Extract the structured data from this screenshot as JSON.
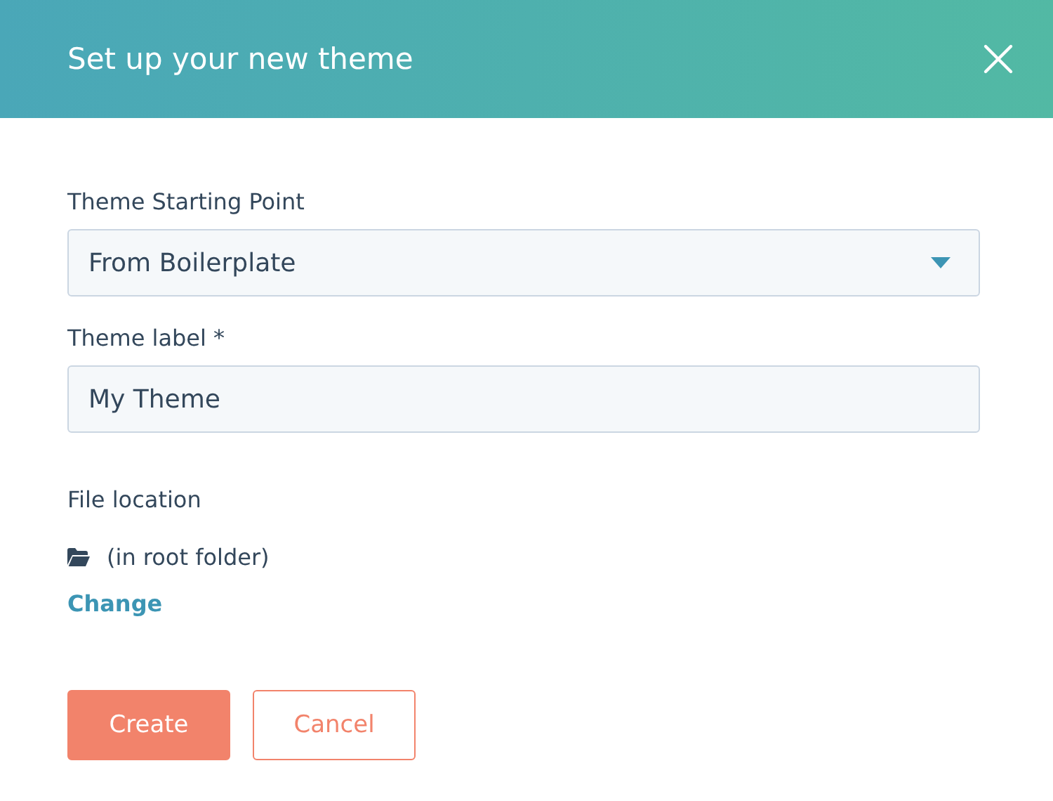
{
  "dialog": {
    "title": "Set up your new theme"
  },
  "fields": [
    {
      "kind": "select",
      "label": "Theme Starting Point",
      "value": "From Boilerplate"
    },
    {
      "kind": "text",
      "label": "Theme label *",
      "value": "My Theme"
    }
  ],
  "file_location": {
    "label": "File location",
    "path": "(in root folder)",
    "link": "Change"
  },
  "buttons": [
    {
      "kind": "primary",
      "label": "Create"
    },
    {
      "kind": "secondary",
      "label": "Cancel"
    }
  ]
}
